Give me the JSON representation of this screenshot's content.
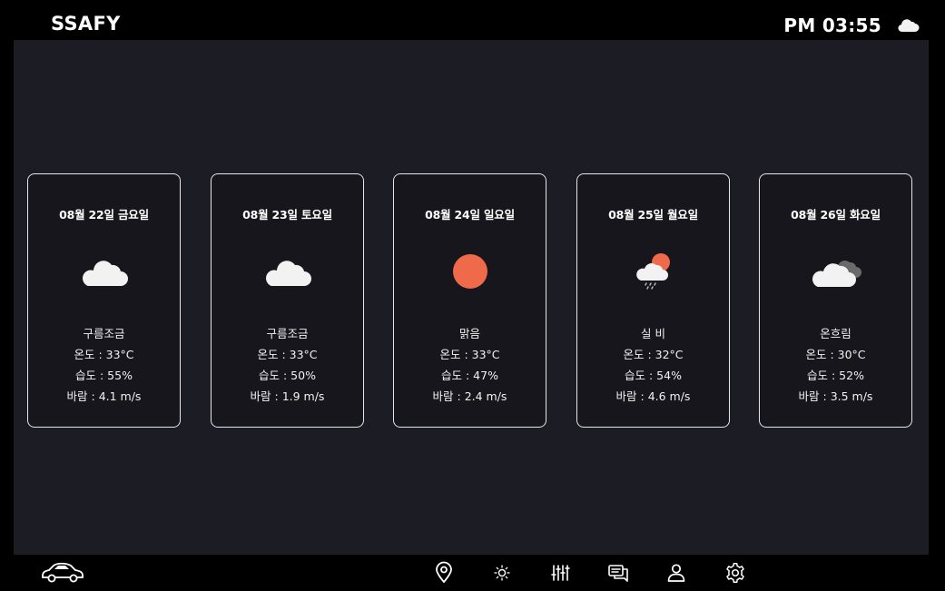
{
  "header": {
    "brand": "SSAFY",
    "time": "PM 03:55",
    "weather_icon": "cloud-icon"
  },
  "forecast": [
    {
      "date": "08월 22일 금요일",
      "icon": "partly-cloudy-icon",
      "condition": "구름조금",
      "temp": "온도 : 33°C",
      "humidity": "습도 : 55%",
      "wind": "바람 : 4.1 m/s"
    },
    {
      "date": "08월 23일 토요일",
      "icon": "partly-cloudy-icon",
      "condition": "구름조금",
      "temp": "온도 : 33°C",
      "humidity": "습도 : 50%",
      "wind": "바람 : 1.9 m/s"
    },
    {
      "date": "08월 24일 일요일",
      "icon": "sun-icon",
      "condition": "맑음",
      "temp": "온도 : 33°C",
      "humidity": "습도 : 47%",
      "wind": "바람 : 2.4 m/s"
    },
    {
      "date": "08월 25일 월요일",
      "icon": "rain-sun-icon",
      "condition": "실 비",
      "temp": "온도 : 32°C",
      "humidity": "습도 : 54%",
      "wind": "바람 : 4.6 m/s"
    },
    {
      "date": "08월 26일 화요일",
      "icon": "overcast-icon",
      "condition": "온흐림",
      "temp": "온도 : 30°C",
      "humidity": "습도 : 52%",
      "wind": "바람 : 3.5 m/s"
    }
  ],
  "nav": {
    "items": [
      "map-pin-icon",
      "brightness-icon",
      "equalizer-icon",
      "chat-icon",
      "user-icon",
      "settings-icon"
    ]
  },
  "colors": {
    "background": "#000000",
    "panel": "#1c1c24",
    "sun": "#ee6a4a",
    "cloud": "#f2f2f2",
    "dark_cloud": "#6a6a6a"
  }
}
